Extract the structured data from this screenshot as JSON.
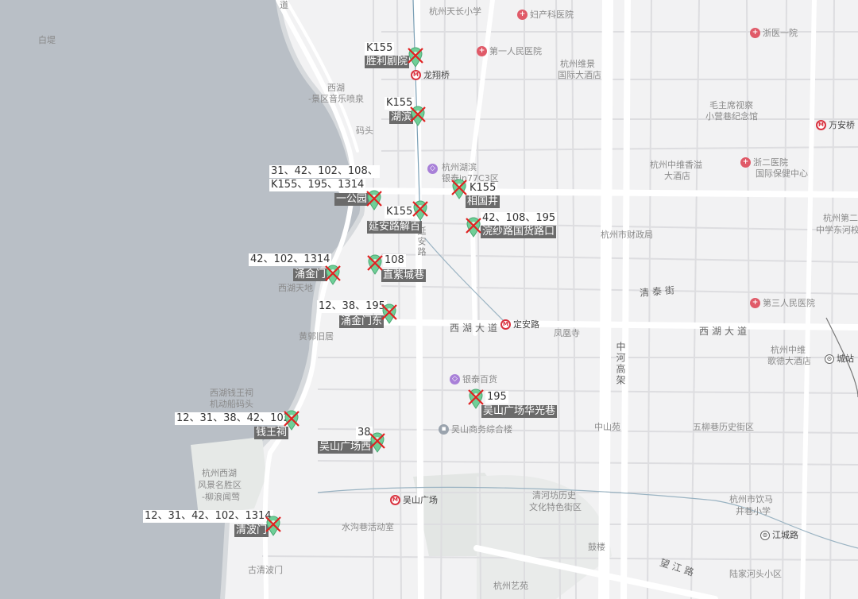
{
  "map": {
    "lake_labels": [
      {
        "id": "baidi",
        "text": "白堤"
      },
      {
        "id": "xihu1",
        "text": "西湖"
      },
      {
        "id": "xihu2",
        "text": "-景区音乐喷泉"
      },
      {
        "id": "matou",
        "text": "码头"
      },
      {
        "id": "yongjin_tiandi",
        "text": "西湖天地"
      },
      {
        "id": "huangpo",
        "text": "黄郭旧居"
      },
      {
        "id": "qianwang_a",
        "text": "西湖钱王祠"
      },
      {
        "id": "qianwang_b",
        "text": "机动船码头"
      },
      {
        "id": "fengjing_a",
        "text": "杭州西湖"
      },
      {
        "id": "fengjing_b",
        "text": "风景名胜区"
      },
      {
        "id": "fengjing_c",
        "text": "-柳浪闻莺"
      },
      {
        "id": "guqing",
        "text": "古清波门"
      },
      {
        "id": "dao",
        "text": "道"
      }
    ],
    "area_labels": [
      {
        "id": "tianchang",
        "text": "杭州天长小学"
      },
      {
        "id": "weijing_a",
        "text": "杭州维景"
      },
      {
        "id": "weijing_b",
        "text": "国际大酒店"
      },
      {
        "id": "mao_a",
        "text": "毛主席视察"
      },
      {
        "id": "mao_b",
        "text": "小营巷纪念馆"
      },
      {
        "id": "zhongwei_a",
        "text": "杭州中维香溢"
      },
      {
        "id": "zhongwei_b",
        "text": "大酒店"
      },
      {
        "id": "hubin_a",
        "text": "杭州湖滨"
      },
      {
        "id": "hubin_b",
        "text": "银泰in77C3区"
      },
      {
        "id": "caizheng",
        "text": "杭州市财政局"
      },
      {
        "id": "fenghuangsi",
        "text": "凤凰寺"
      },
      {
        "id": "zhongshanyuan",
        "text": "中山苑"
      },
      {
        "id": "wuyi",
        "text": "五柳巷历史街区"
      },
      {
        "id": "geju_a",
        "text": "杭州中维"
      },
      {
        "id": "geju_b",
        "text": "歌德大酒店"
      },
      {
        "id": "hangzhou2_a",
        "text": "杭州第二"
      },
      {
        "id": "hangzhou2_b",
        "text": "中学东河校"
      },
      {
        "id": "qinghefang_a",
        "text": "清河坊历史"
      },
      {
        "id": "qinghefang_b",
        "text": "文化特色街区"
      },
      {
        "id": "shuigou",
        "text": "水沟巷活动室"
      },
      {
        "id": "gulou",
        "text": "鼓楼"
      },
      {
        "id": "yinma_a",
        "text": "杭州市饮马"
      },
      {
        "id": "yinma_b",
        "text": "井巷小学"
      },
      {
        "id": "lujia",
        "text": "陆家河头小区"
      },
      {
        "id": "yishu",
        "text": "杭州艺苑"
      }
    ],
    "pois": [
      {
        "id": "fuchan",
        "kind": "hosp",
        "text": "妇产科医院"
      },
      {
        "id": "diyi",
        "kind": "hosp",
        "text": "第一人民医院"
      },
      {
        "id": "zheyi",
        "kind": "hosp",
        "text": "浙医一院"
      },
      {
        "id": "zheer",
        "kind": "hosp",
        "text": "浙二医院"
      },
      {
        "id": "zheer_b",
        "kind": "text",
        "text": "国际保健中心"
      },
      {
        "id": "disan",
        "kind": "hosp",
        "text": "第三人民医院"
      },
      {
        "id": "longxiang",
        "kind": "metro",
        "text": "龙翔桥"
      },
      {
        "id": "wananqiao",
        "kind": "metro",
        "text": "万安桥"
      },
      {
        "id": "dingan",
        "kind": "metro",
        "text": "定安路"
      },
      {
        "id": "wushan_sq",
        "kind": "metro",
        "text": "吴山广场"
      },
      {
        "id": "yintai",
        "kind": "shop",
        "text": "银泰百货"
      },
      {
        "id": "hubin_shop",
        "kind": "shop",
        "text": ""
      },
      {
        "id": "wushan_biz",
        "kind": "build",
        "text": "吴山商务综合楼"
      },
      {
        "id": "chengzhan",
        "kind": "rail",
        "text": "城站"
      },
      {
        "id": "jiangcheng",
        "kind": "rail",
        "text": "江城路"
      }
    ],
    "roads": [
      {
        "id": "xihu_dadao_l",
        "text": "西湖大道"
      },
      {
        "id": "xihu_dadao_r",
        "text": "西湖大道"
      },
      {
        "id": "qingtai",
        "text": "清泰街"
      },
      {
        "id": "wangjiang",
        "text": "望江路"
      },
      {
        "id": "yanan",
        "text": "延安路"
      },
      {
        "id": "zhonghe",
        "text": "中河高架"
      }
    ],
    "bus_stops": [
      {
        "id": "shengli",
        "routes": "K155",
        "name": "胜利剧院"
      },
      {
        "id": "hubin",
        "routes": "K155",
        "name": "湖滨"
      },
      {
        "id": "yigongyuan",
        "routes_line1": "31、42、102、108、",
        "routes_line2": "K155、195、1314",
        "name": "一公园"
      },
      {
        "id": "xiangguojing",
        "routes": "K155",
        "name": "相国井"
      },
      {
        "id": "yananlu",
        "routes": "K155",
        "name": "延安路解百"
      },
      {
        "id": "huansha",
        "routes": "42、108、195",
        "name": "浣纱路国货路口"
      },
      {
        "id": "yongjinmen",
        "routes": "42、102、1314",
        "name": "涌金门"
      },
      {
        "id": "zhizicheng",
        "routes": "108",
        "name": "直紫城巷"
      },
      {
        "id": "yongjindong",
        "routes": "12、38、195",
        "name": "涌金门东"
      },
      {
        "id": "wushan_hg",
        "routes": "195",
        "name": "吴山广场华光巷"
      },
      {
        "id": "qianwangci",
        "routes": "12、31、38、42、102",
        "name": "钱王祠"
      },
      {
        "id": "wushanxi",
        "routes": "38",
        "name": "吴山广场西"
      },
      {
        "id": "qingbomen",
        "routes": "12、31、42、102、1314",
        "name": "清波门"
      }
    ]
  },
  "colors": {
    "water": "#b8bec5",
    "land": "#f2f2f3",
    "park": "#e4e7e5",
    "road": "#ffffff",
    "minor": "#dcdcdd",
    "pin": "#6fcf97",
    "cross": "#e02020",
    "stop_label_bg": "#6b6b6b"
  }
}
